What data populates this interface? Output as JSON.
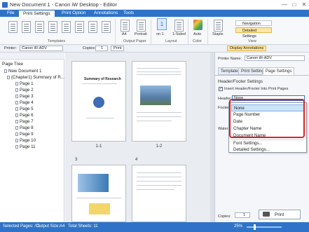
{
  "window": {
    "title": "New Document 1 - Canon iW Desktop - Editor",
    "minimize": "—",
    "maximize": "□",
    "close": "✕"
  },
  "tabs": [
    "File",
    "Print Settings",
    "Print Option",
    "Annotations",
    "Tools"
  ],
  "ribbon": {
    "groups": [
      "Templates",
      "Output Paper",
      "Layout",
      "Color",
      "View"
    ],
    "paper_size": "A4",
    "orientation": "Portrait",
    "pages_per_sheet_value": "1",
    "pages_per_sheet_label": "on 1",
    "sided": "1-Sided",
    "color": "Auto",
    "staple": "Staple",
    "navigation": "Navigation",
    "detailed_settings": "Detailed Settings"
  },
  "printerbar": {
    "printer_label": "Printer:",
    "printer_value": "Canon iR-ADV",
    "copies_label": "Copies:",
    "copies_value": "1",
    "print": "Print",
    "display_annotations": "Display Annotations"
  },
  "tree": {
    "title": "Page Tree",
    "root": "New Document 1",
    "chapter": "(Chapter1) Summary of R...",
    "pages": [
      "Page 1",
      "Page 2",
      "Page 3",
      "Page 4",
      "Page 5",
      "Page 6",
      "Page 7",
      "Page 8",
      "Page 9",
      "Page 10",
      "Page 11"
    ]
  },
  "pages_view": {
    "captions": [
      "1-1",
      "1-2"
    ],
    "page_numbers": [
      "3",
      "4"
    ],
    "page1_title": "Summary of Research"
  },
  "right": {
    "printer_name_label": "Printer Name:",
    "printer_name_value": "Canon iR-ADV",
    "tabs": [
      "Templates",
      "Print Settings",
      "Page Settings"
    ],
    "section": "Header/Footer Settings",
    "insert_label": "Insert Header/Footer Into Print Pages",
    "header_label": "Header:",
    "header_value": "None",
    "footer_label": "Footer:",
    "water_label": "Water",
    "popup_items": [
      "None",
      "Page Number",
      "Date",
      "Chapter Name",
      "Document Name",
      "Font Settings...",
      "Detailed Settings..."
    ],
    "copies_label": "Copies:",
    "copies_value": "1",
    "print_button": "Print"
  },
  "status": {
    "selected": "Selected Pages: /11",
    "output_size": "Output Size:A4",
    "total_sheets": "Total Sheets: 11",
    "zoom": "25%"
  },
  "colors": {
    "accent": "#2e73c7",
    "highlight_red": "#e02020",
    "selected_item": "#cde3f7"
  }
}
